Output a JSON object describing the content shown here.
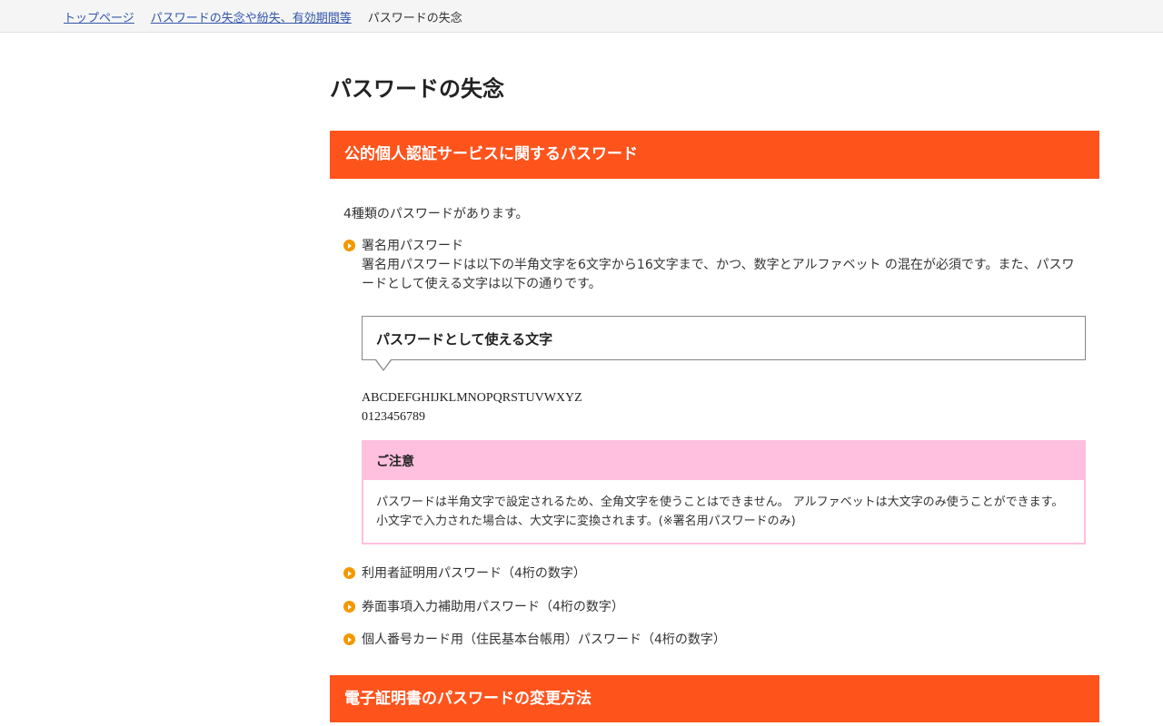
{
  "breadcrumb": {
    "items": [
      {
        "label": "トップページ"
      },
      {
        "label": "パスワードの失念や紛失、有効期間等"
      }
    ],
    "current": "パスワードの失念"
  },
  "page": {
    "title": "パスワードの失念"
  },
  "section1": {
    "heading": "公的個人認証サービスに関するパスワード",
    "intro": "4種類のパスワードがあります。",
    "items": [
      {
        "label": "署名用パスワード",
        "description": "署名用パスワードは以下の半角文字を6文字から16文字まで、かつ、数字とアルファベット の混在が必須です。また、パスワードとして使える文字は以下の通りです。"
      },
      {
        "label": "利用者証明用パスワード（4桁の数字）"
      },
      {
        "label": "券面事項入力補助用パスワード（4桁の数字）"
      },
      {
        "label": "個人番号カード用（住民基本台帳用）パスワード（4桁の数字）"
      }
    ],
    "callout_title": "パスワードとして使える文字",
    "allowed_letters": "ABCDEFGHIJKLMNOPQRSTUVWXYZ",
    "allowed_digits": "0123456789",
    "notice": {
      "heading": "ご注意",
      "body": "パスワードは半角文字で設定されるため、全角文字を使うことはできません。 アルファベットは大文字のみ使うことができます。 小文字で入力された場合は、大文字に変換されます。(※署名用パスワードのみ)"
    }
  },
  "section2": {
    "heading": "電子証明書のパスワードの変更方法"
  },
  "colors": {
    "accent": "#ff531c",
    "bullet": "#f39800",
    "notice": "#ffc0e0",
    "link": "#3355aa"
  }
}
